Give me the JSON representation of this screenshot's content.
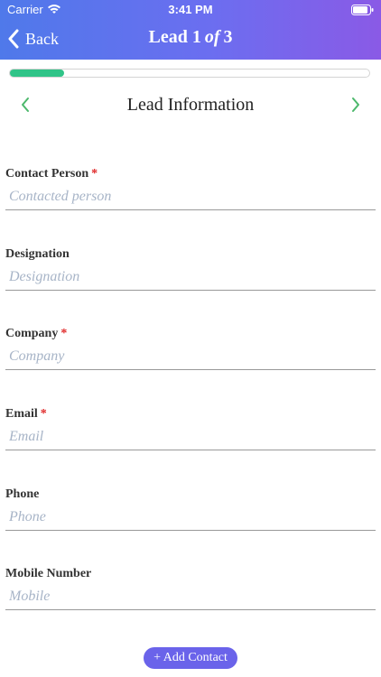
{
  "status_bar": {
    "carrier": "Carrier",
    "time": "3:41 PM"
  },
  "nav": {
    "back_label": "Back",
    "title_prefix": "Lead",
    "current": "1",
    "of_word": "of",
    "total": "3"
  },
  "progress": {
    "fraction": 0.15
  },
  "section": {
    "title": "Lead Information"
  },
  "fields": [
    {
      "label": "Contact Person",
      "required": "*",
      "placeholder": "Contacted person",
      "value": ""
    },
    {
      "label": "Designation",
      "required": "",
      "placeholder": "Designation",
      "value": ""
    },
    {
      "label": "Company",
      "required": "*",
      "placeholder": "Company",
      "value": ""
    },
    {
      "label": "Email",
      "required": "*",
      "placeholder": "Email",
      "value": ""
    },
    {
      "label": "Phone",
      "required": "",
      "placeholder": "Phone",
      "value": ""
    },
    {
      "label": "Mobile Number",
      "required": "",
      "placeholder": "Mobile",
      "value": ""
    }
  ],
  "add_contact_label": "+ Add Contact",
  "colors": {
    "header_gradient_start": "#4f79ea",
    "header_gradient_end": "#8a5ae6",
    "progress": "#30c488",
    "chevron": "#4cb86b",
    "required": "#e02828",
    "button": "#6a63ea"
  }
}
